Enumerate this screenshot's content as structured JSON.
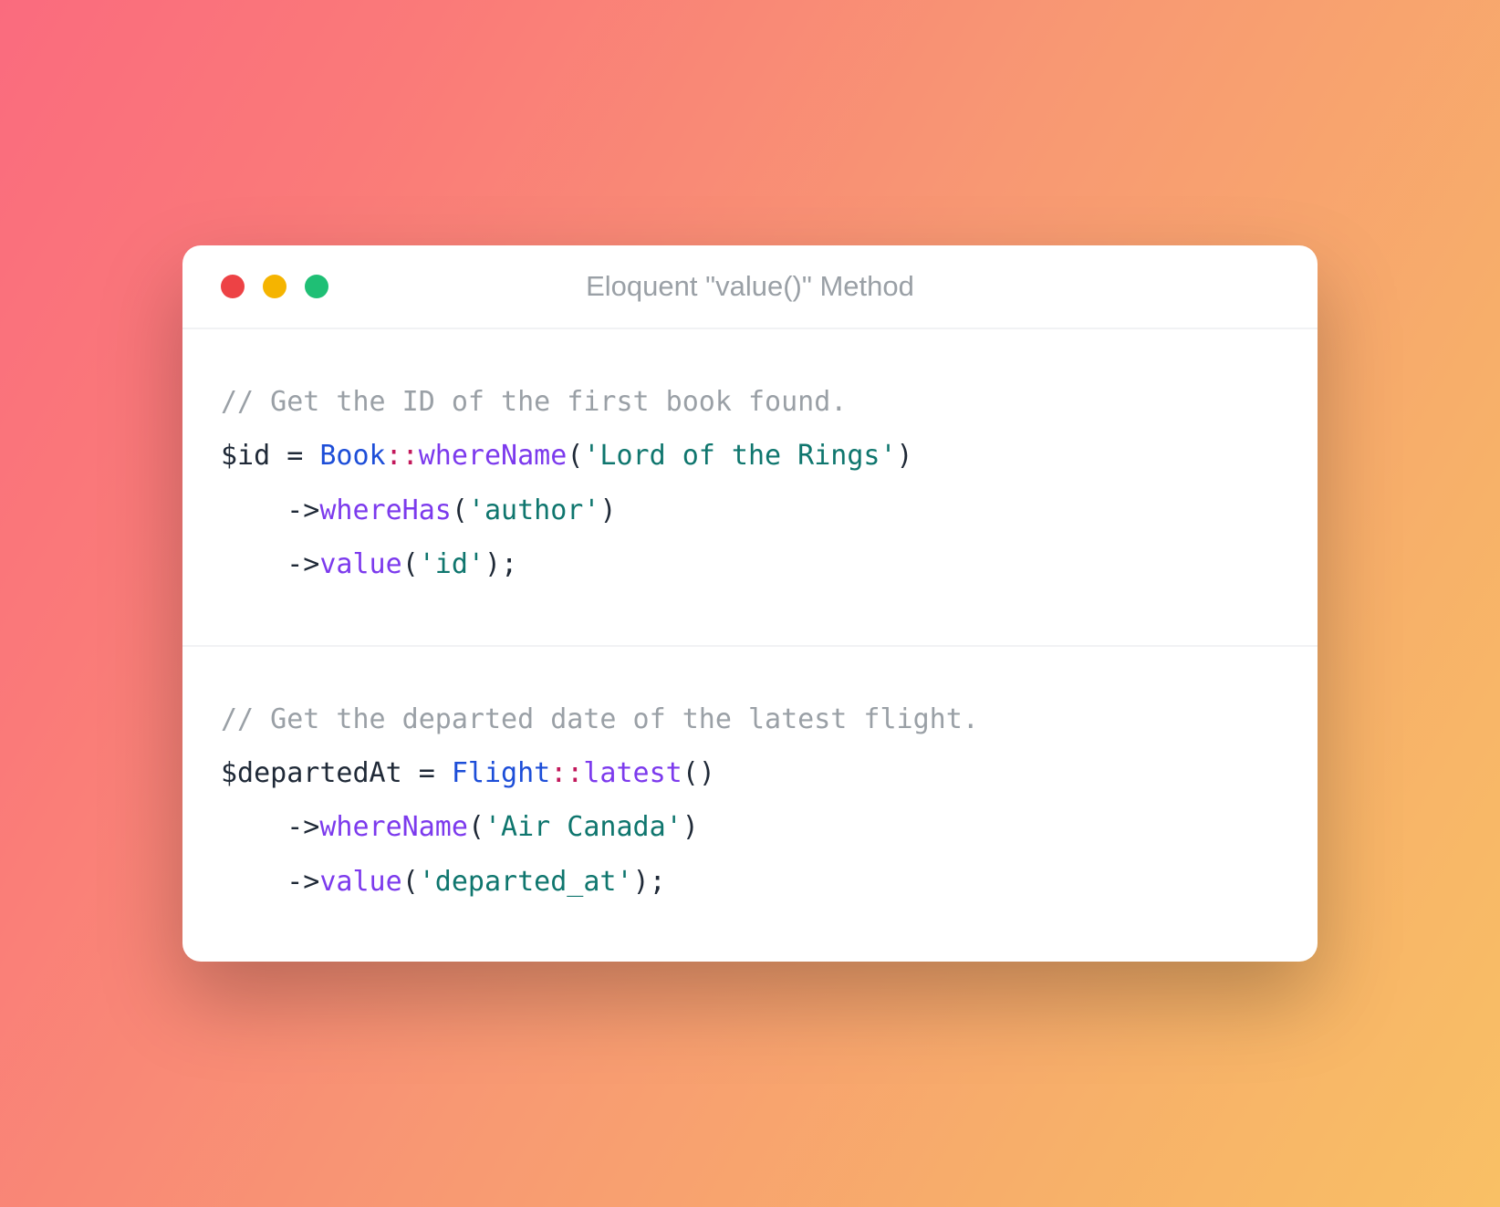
{
  "window": {
    "title": "Eloquent \"value()\" Method"
  },
  "block1": {
    "comment": "// Get the ID of the first book found.",
    "var": "$id",
    "eq": " = ",
    "class": "Book",
    "dbl": "::",
    "m1": "whereName",
    "p1o": "(",
    "s1": "'Lord of the Rings'",
    "p1c": ")",
    "indent": "    ",
    "arrow": "->",
    "m2": "whereHas",
    "p2o": "(",
    "s2": "'author'",
    "p2c": ")",
    "m3": "value",
    "p3o": "(",
    "s3": "'id'",
    "p3c": ")",
    "semi": ";"
  },
  "block2": {
    "comment": "// Get the departed date of the latest flight.",
    "var": "$departedAt",
    "eq": " = ",
    "class": "Flight",
    "dbl": "::",
    "m1": "latest",
    "p1o": "(",
    "p1c": ")",
    "indent": "    ",
    "arrow": "->",
    "m2": "whereName",
    "p2o": "(",
    "s2": "'Air Canada'",
    "p2c": ")",
    "m3": "value",
    "p3o": "(",
    "s3": "'departed_at'",
    "p3c": ")",
    "semi": ";"
  }
}
